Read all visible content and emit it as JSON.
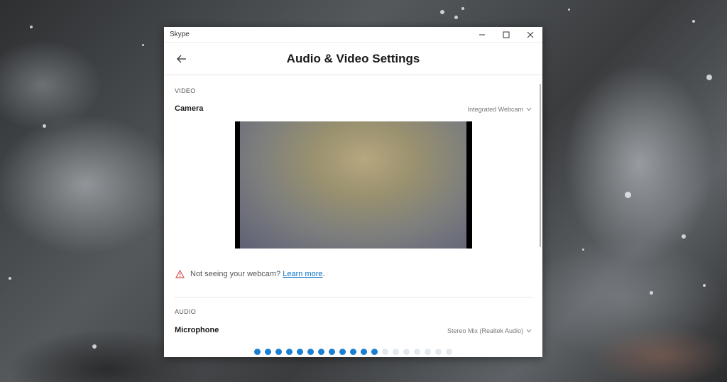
{
  "window": {
    "app_title": "Skype",
    "page_title": "Audio & Video Settings"
  },
  "video": {
    "section_label": "VIDEO",
    "camera_label": "Camera",
    "camera_selected": "Integrated Webcam",
    "warning_text": "Not seeing your webcam?",
    "learn_more": "Learn more",
    "warning_end": "."
  },
  "audio": {
    "section_label": "AUDIO",
    "microphone_label": "Microphone",
    "microphone_selected": "Stereo Mix (Realtek Audio)"
  },
  "mic_level": {
    "active": 12,
    "total": 19
  },
  "colors": {
    "accent": "#1a7fd0",
    "link": "#0b72c3",
    "warning": "#d9534f"
  },
  "icons": [
    "minimize-icon",
    "maximize-icon",
    "close-icon",
    "back-arrow-icon",
    "chevron-down-icon",
    "warning-icon"
  ]
}
